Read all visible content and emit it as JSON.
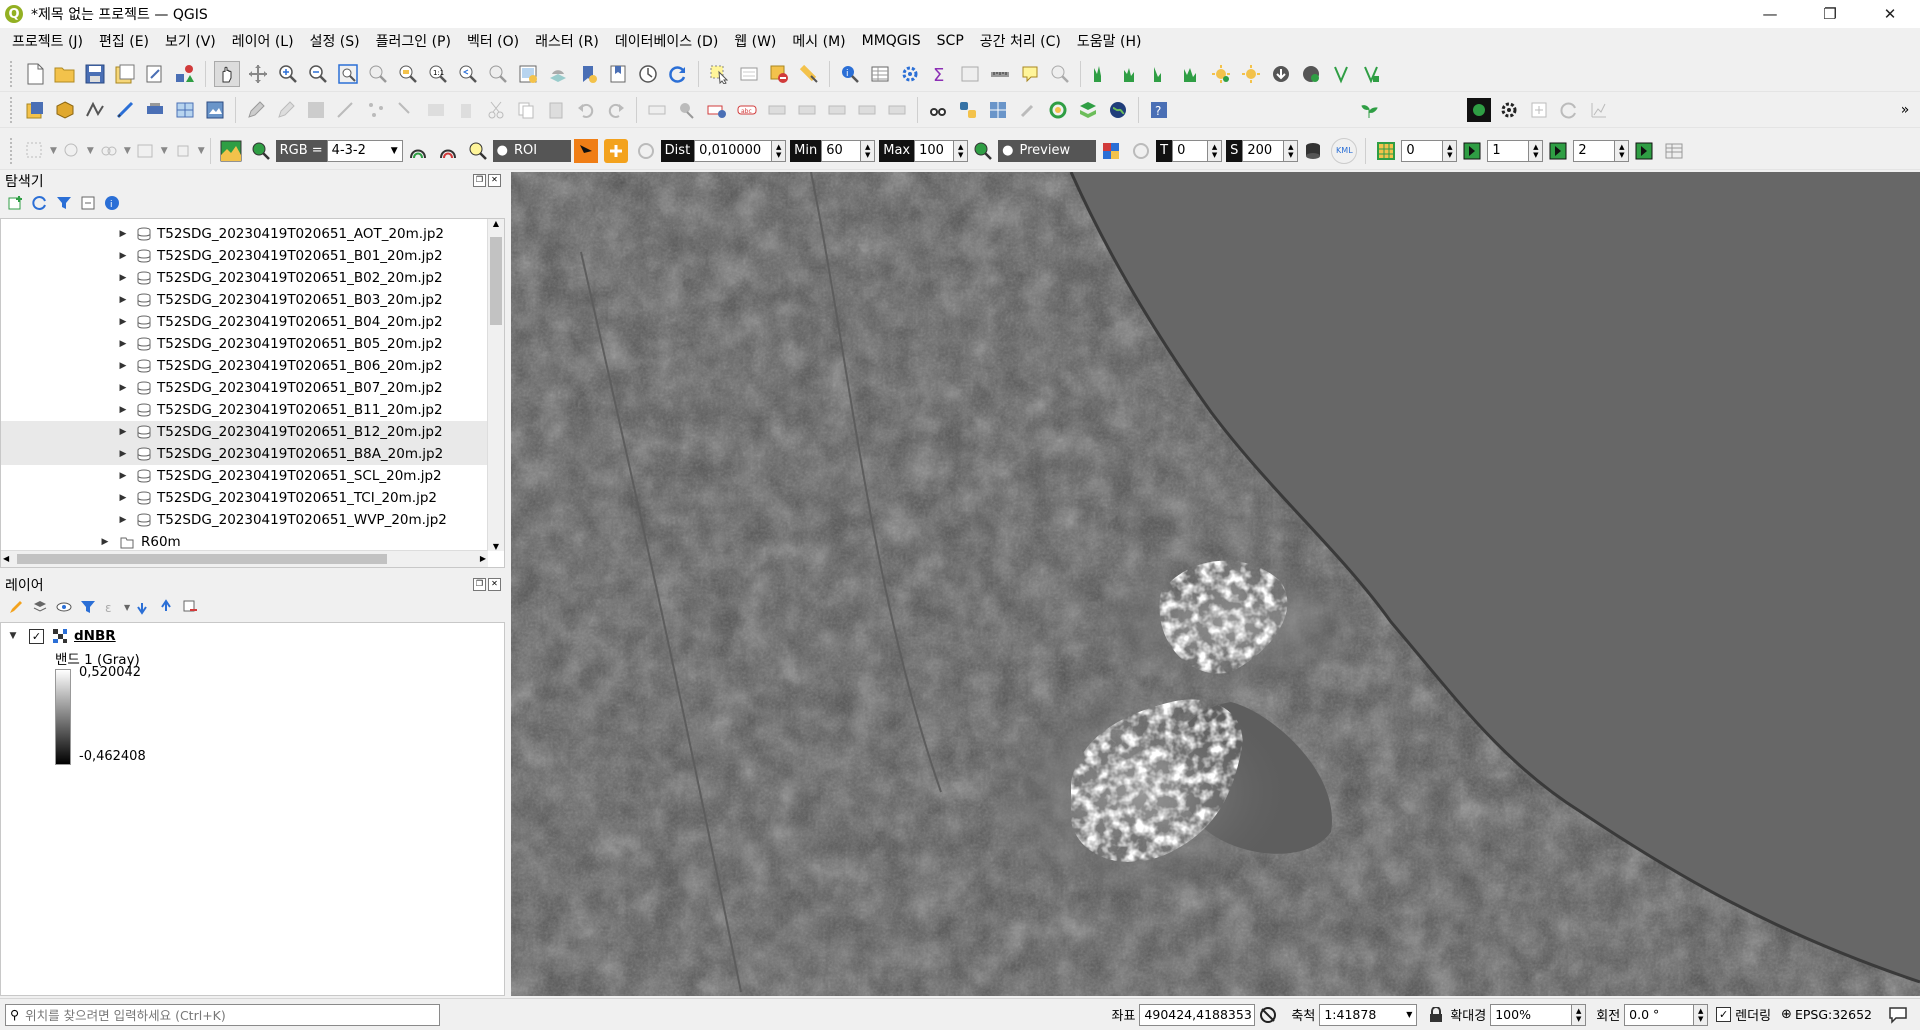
{
  "window": {
    "title": "*제목 없는 프로젝트 — QGIS",
    "minimize": "—",
    "restore": "❐",
    "close": "✕"
  },
  "menu": [
    "프로젝트 (J)",
    "편집 (E)",
    "보기 (V)",
    "레이어 (L)",
    "설정 (S)",
    "플러그인 (P)",
    "벡터 (O)",
    "래스터 (R)",
    "데이터베이스 (D)",
    "웹 (W)",
    "메시 (M)",
    "MMQGIS",
    "SCP",
    "공간 처리 (C)",
    "도움말 (H)"
  ],
  "scp_toolbar": {
    "rgb_label": "RGB =",
    "rgb_value": "4-3-2",
    "roi_label": "ROI",
    "dist_label": "Dist",
    "dist_value": "0,010000",
    "min_label": "Min",
    "min_value": "60",
    "max_label": "Max",
    "max_value": "100",
    "preview_label": "Preview",
    "t_label": "T",
    "t_value": "0",
    "s_label": "S",
    "s_value": "200",
    "kml_label": "KML",
    "field1_value": "0",
    "field2_value": "1",
    "field3_value": "2"
  },
  "browser": {
    "title": "탐색기",
    "items": [
      {
        "label": "T52SDG_20230419T020651_AOT_20m.jp2",
        "selected": false
      },
      {
        "label": "T52SDG_20230419T020651_B01_20m.jp2",
        "selected": false
      },
      {
        "label": "T52SDG_20230419T020651_B02_20m.jp2",
        "selected": false
      },
      {
        "label": "T52SDG_20230419T020651_B03_20m.jp2",
        "selected": false
      },
      {
        "label": "T52SDG_20230419T020651_B04_20m.jp2",
        "selected": false
      },
      {
        "label": "T52SDG_20230419T020651_B05_20m.jp2",
        "selected": false
      },
      {
        "label": "T52SDG_20230419T020651_B06_20m.jp2",
        "selected": false
      },
      {
        "label": "T52SDG_20230419T020651_B07_20m.jp2",
        "selected": false
      },
      {
        "label": "T52SDG_20230419T020651_B11_20m.jp2",
        "selected": false
      },
      {
        "label": "T52SDG_20230419T020651_B12_20m.jp2",
        "selected": true
      },
      {
        "label": "T52SDG_20230419T020651_B8A_20m.jp2",
        "selected": true
      },
      {
        "label": "T52SDG_20230419T020651_SCL_20m.jp2",
        "selected": false
      },
      {
        "label": "T52SDG_20230419T020651_TCI_20m.jp2",
        "selected": false
      },
      {
        "label": "T52SDG_20230419T020651_WVP_20m.jp2",
        "selected": false
      }
    ],
    "folder": "R60m"
  },
  "layers": {
    "title": "레이어",
    "layer_name": "dNBR",
    "band_label": "밴드 1 (Gray)",
    "max_value": "0,520042",
    "min_value": "-0,462408"
  },
  "status": {
    "search_placeholder": "위치를 찾으려면 입력하세요 (Ctrl+K)",
    "coord_label": "좌표",
    "coord_value": "490424,4188353",
    "scale_label": "축척",
    "scale_value": "1:41878",
    "magnifier_label": "확대경",
    "magnifier_value": "100%",
    "rotation_label": "회전",
    "rotation_value": "0.0 °",
    "render_label": "렌더링",
    "crs": "EPSG:32652"
  },
  "colors": {
    "qgis_green": "#93b023",
    "scp_dark": "#111111",
    "selection": "#e9e9e9"
  }
}
